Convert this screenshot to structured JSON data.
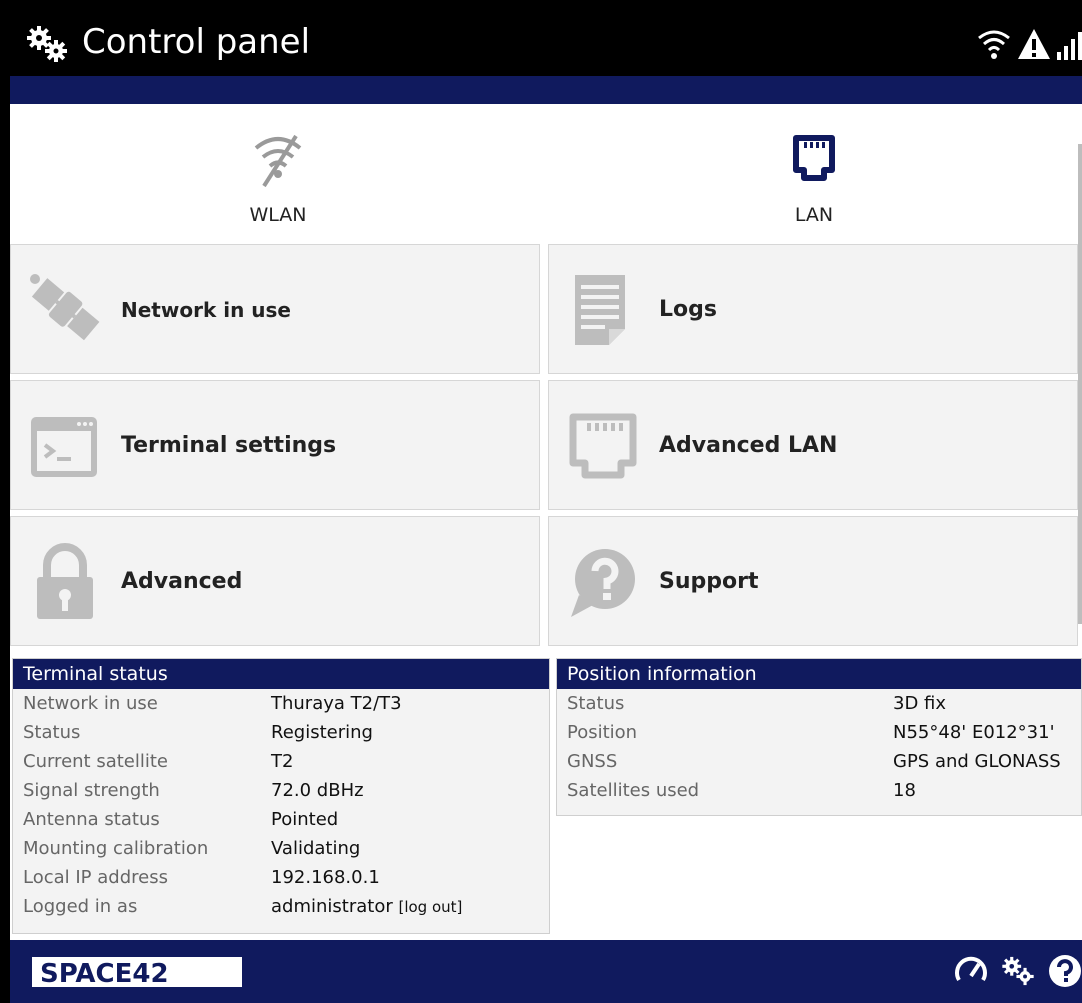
{
  "header": {
    "title": "Control panel",
    "icons": [
      "gears-icon",
      "wifi-icon",
      "warning-icon",
      "signal-bars-icon"
    ]
  },
  "quick_links": [
    {
      "label": "WLAN",
      "icon": "wifi-off-icon"
    },
    {
      "label": "LAN",
      "icon": "lan-port-icon"
    }
  ],
  "tiles": [
    {
      "label": "Network in use",
      "icon": "satellite-icon"
    },
    {
      "label": "Logs",
      "icon": "document-icon"
    },
    {
      "label": "Terminal settings",
      "icon": "terminal-icon"
    },
    {
      "label": "Advanced LAN",
      "icon": "lan-port-icon"
    },
    {
      "label": "Advanced",
      "icon": "lock-icon"
    },
    {
      "label": "Support",
      "icon": "question-bubble-icon"
    }
  ],
  "terminal_status": {
    "title": "Terminal status",
    "rows": [
      {
        "key": "Network in use",
        "value": "Thuraya T2/T3"
      },
      {
        "key": "Status",
        "value": "Registering"
      },
      {
        "key": "Current satellite",
        "value": "T2"
      },
      {
        "key": "Signal strength",
        "value": "72.0 dBHz"
      },
      {
        "key": "Antenna status",
        "value": "Pointed"
      },
      {
        "key": "Mounting calibration",
        "value": "Validating"
      },
      {
        "key": "Local IP address",
        "value": "192.168.0.1"
      },
      {
        "key": "Logged in as",
        "value": "administrator",
        "link": "[log out]"
      }
    ]
  },
  "position_information": {
    "title": "Position information",
    "rows": [
      {
        "key": "Status",
        "value": "3D fix"
      },
      {
        "key": "Position",
        "value": "N55°48' E012°31'"
      },
      {
        "key": "GNSS",
        "value": "GPS and GLONASS"
      },
      {
        "key": "Satellites used",
        "value": "18"
      }
    ]
  },
  "footer": {
    "logo": "SPACE42",
    "icons": [
      "dashboard-icon",
      "gears-icon",
      "help-icon"
    ]
  },
  "colors": {
    "navy": "#101a5e",
    "tile_bg": "#f3f3f3",
    "icon_gray": "#b8b8b8"
  }
}
